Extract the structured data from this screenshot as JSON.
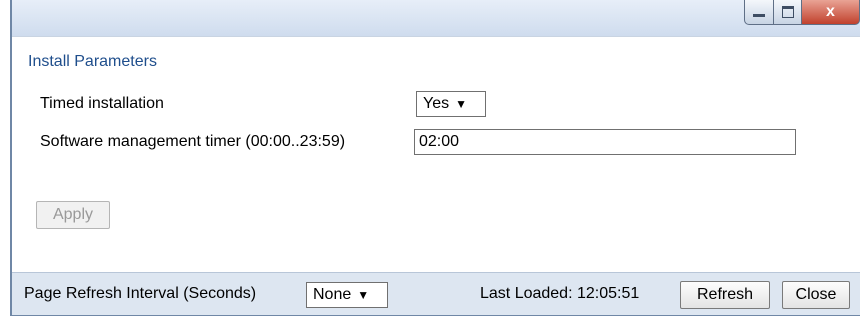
{
  "window": {
    "controls": {
      "minimize_icon": "minimize-icon",
      "maximize_icon": "maximize-icon",
      "close_label": "x"
    }
  },
  "section": {
    "title": "Install Parameters"
  },
  "form": {
    "timed_installation": {
      "label": "Timed installation",
      "value": "Yes",
      "arrow": "▼"
    },
    "timer": {
      "label": "Software management timer (00:00..23:59)",
      "value": "02:00"
    },
    "apply_label": "Apply"
  },
  "footer": {
    "refresh_interval_label": "Page Refresh Interval (Seconds)",
    "refresh_interval_value": "None",
    "refresh_interval_arrow": "▼",
    "last_loaded": "Last Loaded: 12:05:51",
    "refresh_label": "Refresh",
    "close_label": "Close"
  }
}
